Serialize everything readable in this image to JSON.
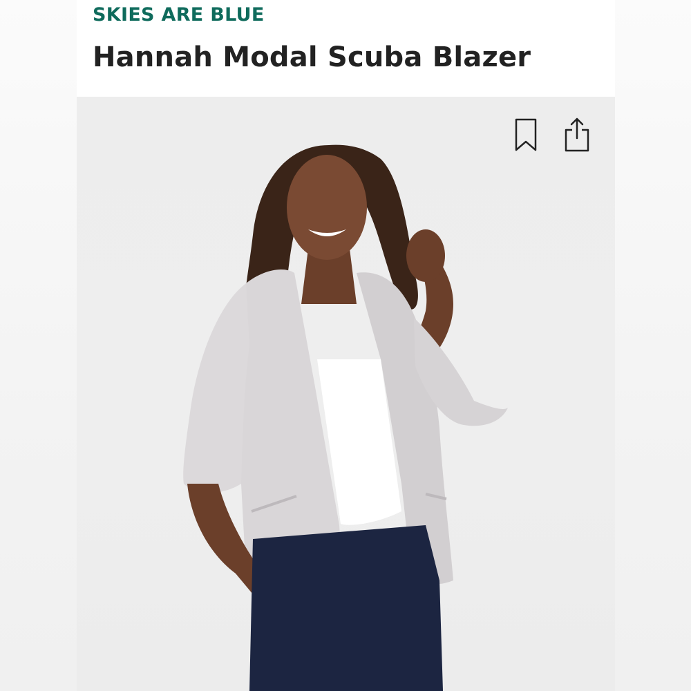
{
  "listing": {
    "brand": "SKIES ARE BLUE",
    "title": "Hannah Modal Scuba Blazer"
  },
  "actions": {
    "bookmark_icon": "bookmark-icon",
    "share_icon": "share-icon"
  },
  "colors": {
    "brand": "#0f6b5c",
    "title": "#222222",
    "blazer": "#d9d6d8",
    "pants": "#1c2541",
    "top": "#ffffff"
  }
}
